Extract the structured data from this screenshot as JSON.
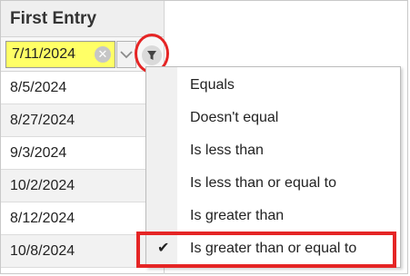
{
  "column": {
    "header": "First Entry",
    "filter_value": "7/11/2024",
    "rows": [
      "8/5/2024",
      "8/27/2024",
      "9/3/2024",
      "10/2/2024",
      "8/12/2024",
      "10/8/2024"
    ]
  },
  "icons": {
    "clear": "clear-circle-icon",
    "dropdown": "chevron-down-icon",
    "filter": "filter-icon",
    "check": "checkmark-icon"
  },
  "menu": {
    "items": [
      "Equals",
      "Doesn't equal",
      "Is less than",
      "Is less than or equal to",
      "Is greater than",
      "Is greater than or equal to"
    ],
    "selected": "Is greater than or equal to"
  },
  "annotation_color": "#e52525",
  "input_highlight_color": "#ffff66"
}
